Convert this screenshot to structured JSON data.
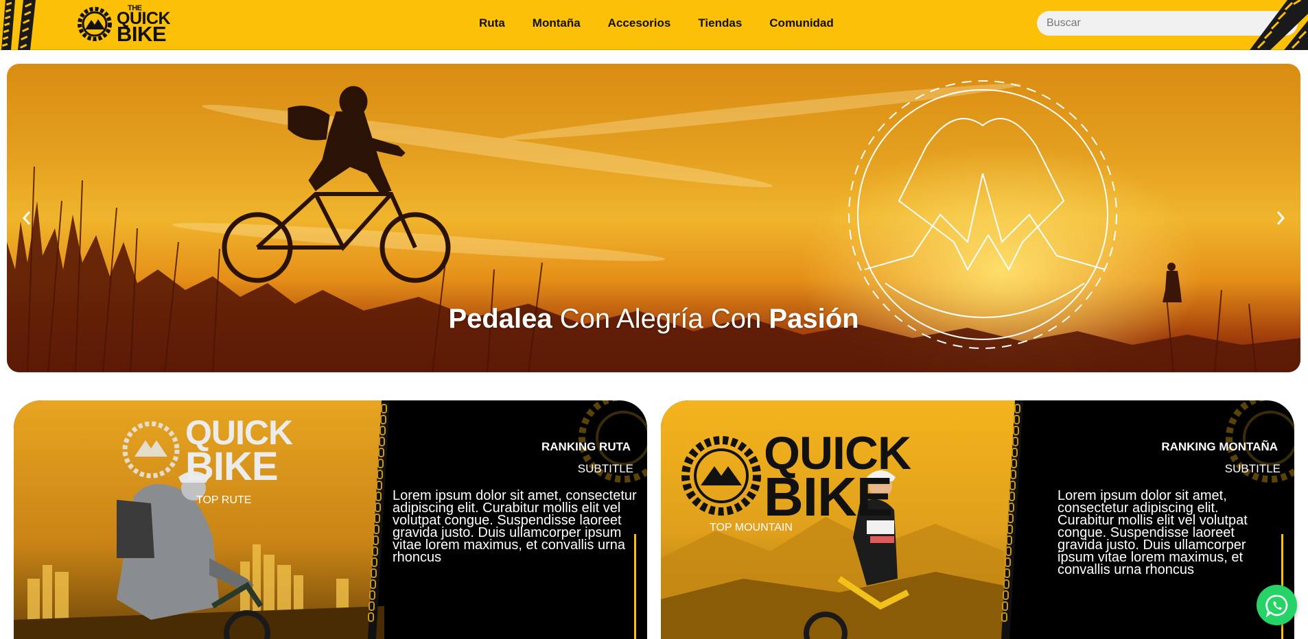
{
  "header": {
    "logo": {
      "line1": "THE",
      "line2": "QUICK",
      "line3": "BIKE"
    },
    "nav": [
      {
        "label": "Ruta"
      },
      {
        "label": "Montaña"
      },
      {
        "label": "Accesorios"
      },
      {
        "label": "Tiendas"
      },
      {
        "label": "Comunidad"
      }
    ],
    "search": {
      "placeholder": "Buscar",
      "icon": "search-icon"
    }
  },
  "hero": {
    "caption_bold_1": "Pedalea",
    "caption_regular": " Con Alegría Con ",
    "caption_bold_2": "Pasión",
    "prev_icon": "chevron-left-icon",
    "next_icon": "chevron-right-icon"
  },
  "cards": [
    {
      "logo_line1": "QUICK",
      "logo_line2": "BIKE",
      "tag": "TOP RUTE",
      "title": "RANKING RUTA",
      "subtitle": "SUBTITLE",
      "text": "Lorem ipsum dolor sit amet, consectetur adipiscing elit. Curabitur mollis elit vel volutpat congue. Suspendisse laoreet gravida justo. Duis ullamcorper ipsum vitae lorem maximus, et convallis urna rhoncus"
    },
    {
      "logo_line1": "QUICK",
      "logo_line2": "BIKE",
      "tag": "TOP MOUNTAIN",
      "title": "RANKING MONTAÑA",
      "subtitle": "SUBTITLE",
      "text": "Lorem ipsum dolor sit amet, consectetur adipiscing elit. Curabitur mollis elit vel volutpat congue. Suspendisse laoreet gravida justo. Duis ullamcorper ipsum vitae lorem maximus, et convallis urna rhoncus"
    }
  ],
  "whatsapp": {
    "icon": "whatsapp-icon",
    "color": "#25d366"
  },
  "colors": {
    "brand_yellow": "#fcc006",
    "black": "#000000"
  }
}
